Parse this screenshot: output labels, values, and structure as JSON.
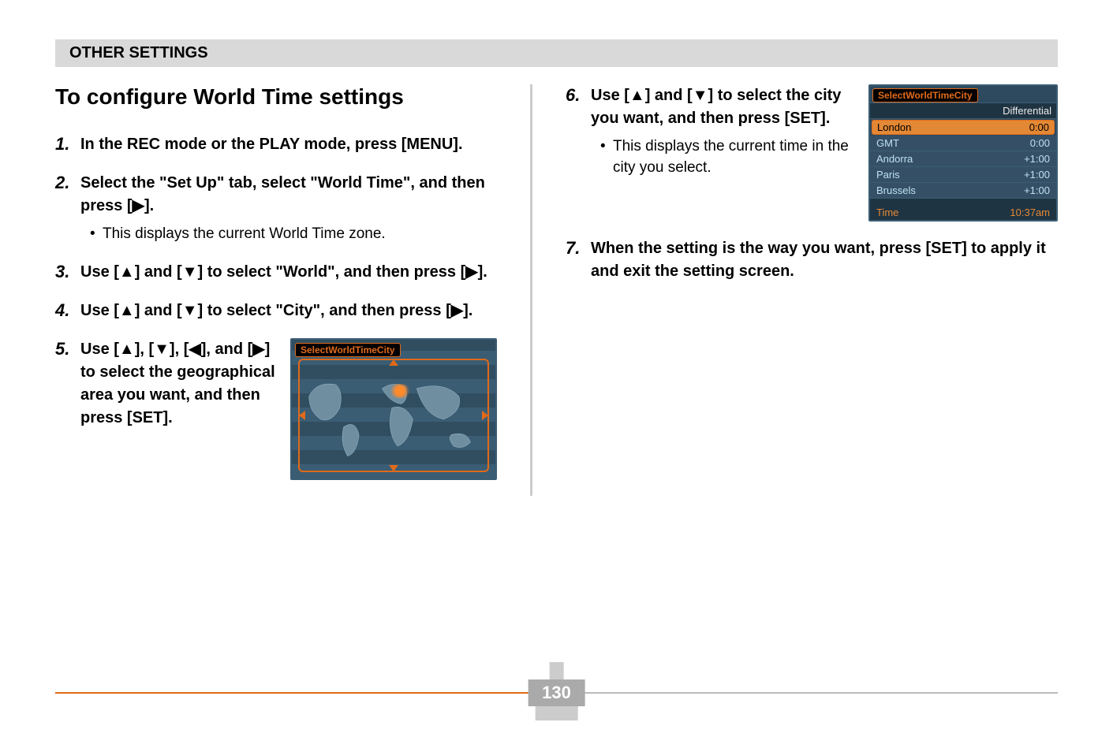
{
  "header": {
    "section": "OTHER SETTINGS"
  },
  "title": "To configure World Time settings",
  "steps_left": [
    {
      "n": "1.",
      "main": "In the REC mode or the PLAY mode, press [MENU]."
    },
    {
      "n": "2.",
      "main": "Select the \"Set Up\" tab, select \"World Time\", and then press [▶].",
      "bullets": [
        "This displays the current World Time zone."
      ]
    },
    {
      "n": "3.",
      "main": "Use [▲] and [▼] to select \"World\", and then press [▶]."
    },
    {
      "n": "4.",
      "main": "Use [▲] and [▼] to select \"City\", and then press [▶]."
    },
    {
      "n": "5.",
      "main": "Use [▲], [▼], [◀], and [▶] to select the geographical area you want, and then press [SET]."
    }
  ],
  "steps_right": [
    {
      "n": "6.",
      "main": "Use [▲] and [▼] to select the city you want, and then press [SET].",
      "bullets": [
        "This displays the current time in the city you select."
      ]
    },
    {
      "n": "7.",
      "main": "When the setting is the way you want, press [SET] to apply it and exit the setting screen."
    }
  ],
  "lcd_map": {
    "title": "SelectWorldTimeCity"
  },
  "lcd_list": {
    "title": "SelectWorldTimeCity",
    "diff_header": "Differential",
    "rows": [
      {
        "city": "London",
        "diff": "0:00",
        "selected": true
      },
      {
        "city": "GMT",
        "diff": "0:00"
      },
      {
        "city": "Andorra",
        "diff": "+1:00"
      },
      {
        "city": "Paris",
        "diff": "+1:00"
      },
      {
        "city": "Brussels",
        "diff": "+1:00"
      }
    ],
    "time_label": "Time",
    "time_value": "10:37am"
  },
  "page_number": "130"
}
